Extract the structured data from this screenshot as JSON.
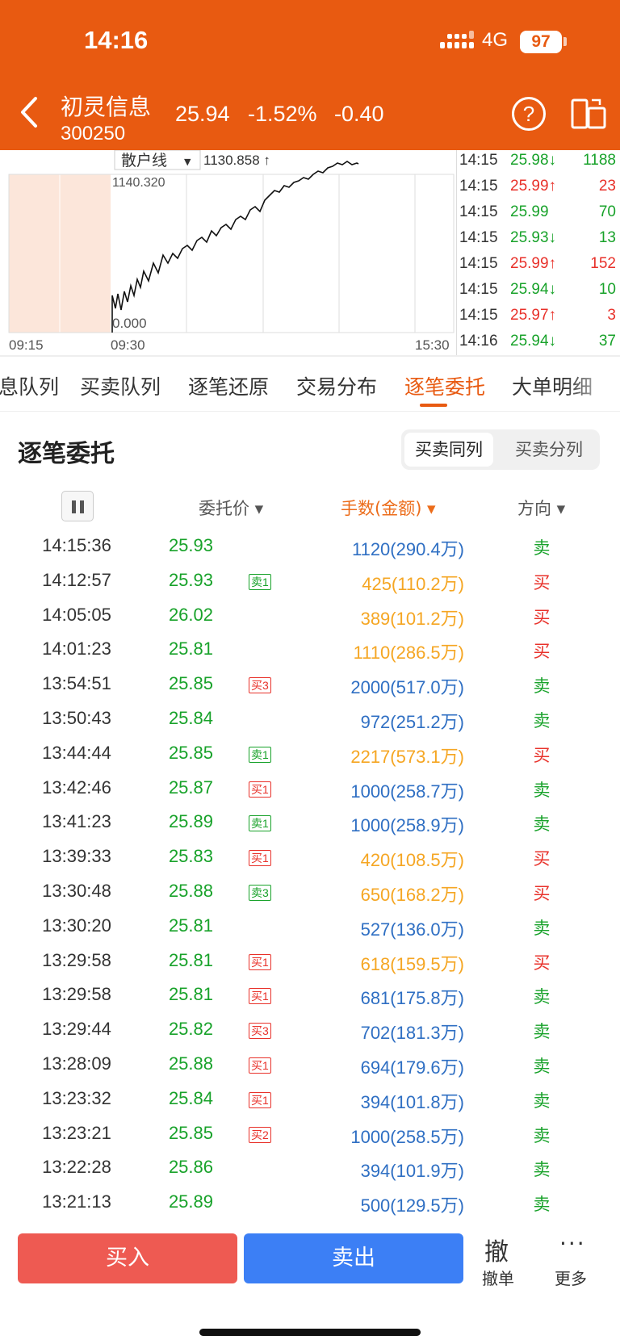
{
  "status_bar": {
    "time": "14:16",
    "network": "4G",
    "battery": "97"
  },
  "header": {
    "name": "初灵信息",
    "code": "300250",
    "price": "25.94",
    "change_pct": "-1.52%",
    "change": "-0.40"
  },
  "chart": {
    "selector": "散户线",
    "selector_value": "1130.858 ↑",
    "y_top": "1140.320",
    "y_bottom": "0.000",
    "x_labels": [
      "09:15",
      "09:30",
      "15:30"
    ]
  },
  "trades": [
    {
      "time": "14:15",
      "price": "25.98↓",
      "vol": "1188",
      "dir": "down"
    },
    {
      "time": "14:15",
      "price": "25.99↑",
      "vol": "23",
      "dir": "up"
    },
    {
      "time": "14:15",
      "price": "25.99",
      "vol": "70",
      "dir": "flat"
    },
    {
      "time": "14:15",
      "price": "25.93↓",
      "vol": "13",
      "dir": "down"
    },
    {
      "time": "14:15",
      "price": "25.99↑",
      "vol": "152",
      "dir": "up"
    },
    {
      "time": "14:15",
      "price": "25.94↓",
      "vol": "10",
      "dir": "down"
    },
    {
      "time": "14:15",
      "price": "25.97↑",
      "vol": "3",
      "dir": "up"
    },
    {
      "time": "14:16",
      "price": "25.94↓",
      "vol": "37",
      "dir": "down"
    }
  ],
  "tabs": [
    "息队列",
    "买卖队列",
    "逐笔还原",
    "交易分布",
    "逐笔委托",
    "大单明细"
  ],
  "active_tab": 4,
  "section": {
    "title": "逐笔委托",
    "seg_a": "买卖同列",
    "seg_b": "买卖分列"
  },
  "columns": {
    "price": "委托价 ▾",
    "volume": "手数(金额) ▾",
    "direction": "方向 ▾"
  },
  "orders": [
    {
      "time": "14:15:36",
      "price": "25.93",
      "tag": "",
      "tag_type": "",
      "vol": "1120(290.4万)",
      "vol_color": "blue",
      "dir": "卖",
      "dir_type": "sell"
    },
    {
      "time": "14:12:57",
      "price": "25.93",
      "tag": "卖1",
      "tag_type": "sell",
      "vol": "425(110.2万)",
      "vol_color": "orange",
      "dir": "买",
      "dir_type": "buy"
    },
    {
      "time": "14:05:05",
      "price": "26.02",
      "tag": "",
      "tag_type": "",
      "vol": "389(101.2万)",
      "vol_color": "orange",
      "dir": "买",
      "dir_type": "buy"
    },
    {
      "time": "14:01:23",
      "price": "25.81",
      "tag": "",
      "tag_type": "",
      "vol": "1110(286.5万)",
      "vol_color": "orange",
      "dir": "买",
      "dir_type": "buy"
    },
    {
      "time": "13:54:51",
      "price": "25.85",
      "tag": "买3",
      "tag_type": "buy",
      "vol": "2000(517.0万)",
      "vol_color": "blue",
      "dir": "卖",
      "dir_type": "sell"
    },
    {
      "time": "13:50:43",
      "price": "25.84",
      "tag": "",
      "tag_type": "",
      "vol": "972(251.2万)",
      "vol_color": "blue",
      "dir": "卖",
      "dir_type": "sell"
    },
    {
      "time": "13:44:44",
      "price": "25.85",
      "tag": "卖1",
      "tag_type": "sell",
      "vol": "2217(573.1万)",
      "vol_color": "orange",
      "dir": "买",
      "dir_type": "buy"
    },
    {
      "time": "13:42:46",
      "price": "25.87",
      "tag": "买1",
      "tag_type": "buy",
      "vol": "1000(258.7万)",
      "vol_color": "blue",
      "dir": "卖",
      "dir_type": "sell"
    },
    {
      "time": "13:41:23",
      "price": "25.89",
      "tag": "卖1",
      "tag_type": "sell",
      "vol": "1000(258.9万)",
      "vol_color": "blue",
      "dir": "卖",
      "dir_type": "sell"
    },
    {
      "time": "13:39:33",
      "price": "25.83",
      "tag": "买1",
      "tag_type": "buy",
      "vol": "420(108.5万)",
      "vol_color": "orange",
      "dir": "买",
      "dir_type": "buy"
    },
    {
      "time": "13:30:48",
      "price": "25.88",
      "tag": "卖3",
      "tag_type": "sell",
      "vol": "650(168.2万)",
      "vol_color": "orange",
      "dir": "买",
      "dir_type": "buy"
    },
    {
      "time": "13:30:20",
      "price": "25.81",
      "tag": "",
      "tag_type": "",
      "vol": "527(136.0万)",
      "vol_color": "blue",
      "dir": "卖",
      "dir_type": "sell"
    },
    {
      "time": "13:29:58",
      "price": "25.81",
      "tag": "买1",
      "tag_type": "buy",
      "vol": "618(159.5万)",
      "vol_color": "orange",
      "dir": "买",
      "dir_type": "buy"
    },
    {
      "time": "13:29:58",
      "price": "25.81",
      "tag": "买1",
      "tag_type": "buy",
      "vol": "681(175.8万)",
      "vol_color": "blue",
      "dir": "卖",
      "dir_type": "sell"
    },
    {
      "time": "13:29:44",
      "price": "25.82",
      "tag": "买3",
      "tag_type": "buy",
      "vol": "702(181.3万)",
      "vol_color": "blue",
      "dir": "卖",
      "dir_type": "sell"
    },
    {
      "time": "13:28:09",
      "price": "25.88",
      "tag": "买1",
      "tag_type": "buy",
      "vol": "694(179.6万)",
      "vol_color": "blue",
      "dir": "卖",
      "dir_type": "sell"
    },
    {
      "time": "13:23:32",
      "price": "25.84",
      "tag": "买1",
      "tag_type": "buy",
      "vol": "394(101.8万)",
      "vol_color": "blue",
      "dir": "卖",
      "dir_type": "sell"
    },
    {
      "time": "13:23:21",
      "price": "25.85",
      "tag": "买2",
      "tag_type": "buy",
      "vol": "1000(258.5万)",
      "vol_color": "blue",
      "dir": "卖",
      "dir_type": "sell"
    },
    {
      "time": "13:22:28",
      "price": "25.86",
      "tag": "",
      "tag_type": "",
      "vol": "394(101.9万)",
      "vol_color": "blue",
      "dir": "卖",
      "dir_type": "sell"
    },
    {
      "time": "13:21:13",
      "price": "25.89",
      "tag": "",
      "tag_type": "",
      "vol": "500(129.5万)",
      "vol_color": "blue",
      "dir": "卖",
      "dir_type": "sell"
    }
  ],
  "bottom": {
    "buy": "买入",
    "sell": "卖出",
    "cancel_glyph": "撤",
    "cancel": "撤单",
    "more_dots": "···",
    "more": "更多"
  },
  "colors": {
    "header": "#e85a11",
    "up": "#e8312a",
    "down": "#18a22a",
    "blue": "#2f6fc3",
    "orange": "#f5a623"
  }
}
